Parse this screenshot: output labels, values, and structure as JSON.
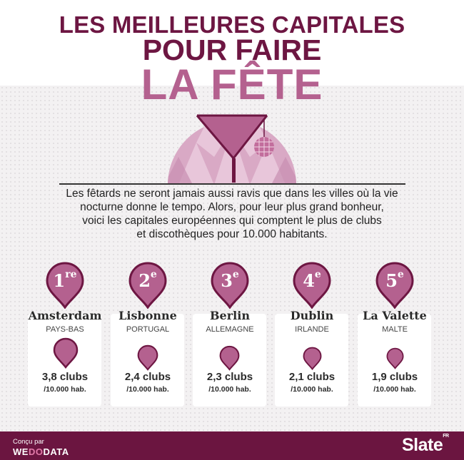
{
  "header": {
    "line1": "LES MEILLEURES CAPITALES",
    "line2": "POUR FAIRE",
    "line3": "LA FÊTE"
  },
  "intro": {
    "line1": "Les fêtards ne seront jamais aussi ravis que dans les villes où la vie",
    "line2": "nocturne donne le tempo. Alors, pour leur plus grand bonheur,",
    "line3": "voici les capitales européennes qui comptent le plus de clubs",
    "line4": "et discothèques pour 10.000 habitants."
  },
  "unit": "/10.000 hab.",
  "ranking": [
    {
      "rank": "1",
      "suffix": "re",
      "city": "Amsterdam",
      "country": "PAYS-BAS",
      "clubs": 3.8,
      "label": "3,8 clubs"
    },
    {
      "rank": "2",
      "suffix": "e",
      "city": "Lisbonne",
      "country": "PORTUGAL",
      "clubs": 2.4,
      "label": "2,4 clubs"
    },
    {
      "rank": "3",
      "suffix": "e",
      "city": "Berlin",
      "country": "ALLEMAGNE",
      "clubs": 2.3,
      "label": "2,3 clubs"
    },
    {
      "rank": "4",
      "suffix": "e",
      "city": "Dublin",
      "country": "IRLANDE",
      "clubs": 2.1,
      "label": "2,1 clubs"
    },
    {
      "rank": "5",
      "suffix": "e",
      "city": "La Valette",
      "country": "MALTE",
      "clubs": 1.9,
      "label": "1,9 clubs"
    }
  ],
  "footer": {
    "credit_label": "Conçu par",
    "brand_a": "WE",
    "brand_b": "DO",
    "brand_c": "DATA",
    "publisher": "Slate",
    "publisher_edition": "FR"
  },
  "colors": {
    "dark_plum": "#6d1642",
    "pink": "#b4618f",
    "footer": "#6b1540",
    "wedodata_accent": "#e27aa9"
  },
  "icons": [
    "cocktail-glass-icon",
    "disco-ball-icon",
    "map-pin-icon",
    "bubble-marker-icon"
  ]
}
